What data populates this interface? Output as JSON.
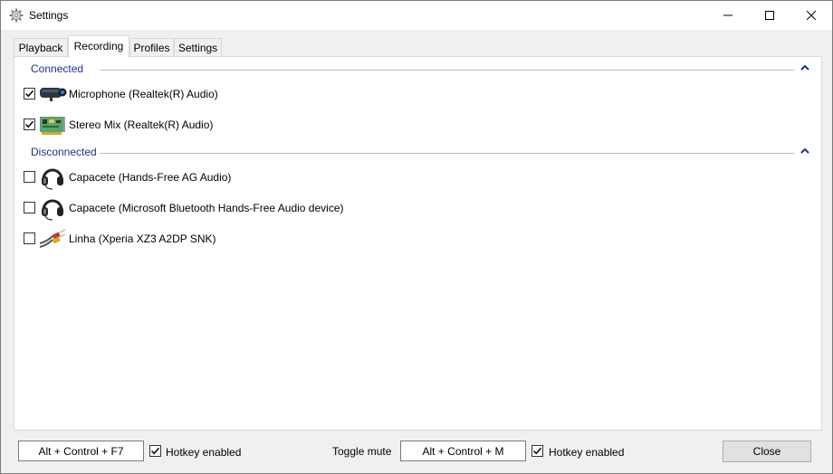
{
  "window": {
    "title": "Settings",
    "icon": "gear-icon",
    "controls": [
      "minimize-icon",
      "maximize-icon",
      "close-icon"
    ]
  },
  "tabs": [
    {
      "label": "Playback",
      "active": false
    },
    {
      "label": "Recording",
      "active": true
    },
    {
      "label": "Profiles",
      "active": false
    },
    {
      "label": "Settings",
      "active": false
    }
  ],
  "groups": {
    "connected": {
      "label": "Connected",
      "devices": [
        {
          "label": "Microphone (Realtek(R) Audio)",
          "checked": true,
          "icon": "webcam-microphone-icon"
        },
        {
          "label": "Stereo Mix (Realtek(R) Audio)",
          "checked": true,
          "icon": "sound-card-icon"
        }
      ]
    },
    "disconnected": {
      "label": "Disconnected",
      "devices": [
        {
          "label": "Capacete (Hands-Free AG Audio)",
          "checked": false,
          "icon": "headset-icon"
        },
        {
          "label": "Capacete (Microsoft Bluetooth Hands-Free Audio device)",
          "checked": false,
          "icon": "headset-icon"
        },
        {
          "label": "Linha (Xperia XZ3 A2DP SNK)",
          "checked": false,
          "icon": "line-in-cable-icon"
        }
      ]
    }
  },
  "bottom": {
    "hotkey1": "Alt + Control + F7",
    "hotkey1_enabled_label": "Hotkey enabled",
    "hotkey1_enabled": true,
    "toggle_mute_label": "Toggle mute",
    "hotkey2": "Alt + Control + M",
    "hotkey2_enabled_label": "Hotkey enabled",
    "hotkey2_enabled": true,
    "close_label": "Close"
  },
  "colors": {
    "group_label": "#1e3287",
    "group_line": "#b4bcd8",
    "window_bg": "#f0f0f0"
  }
}
